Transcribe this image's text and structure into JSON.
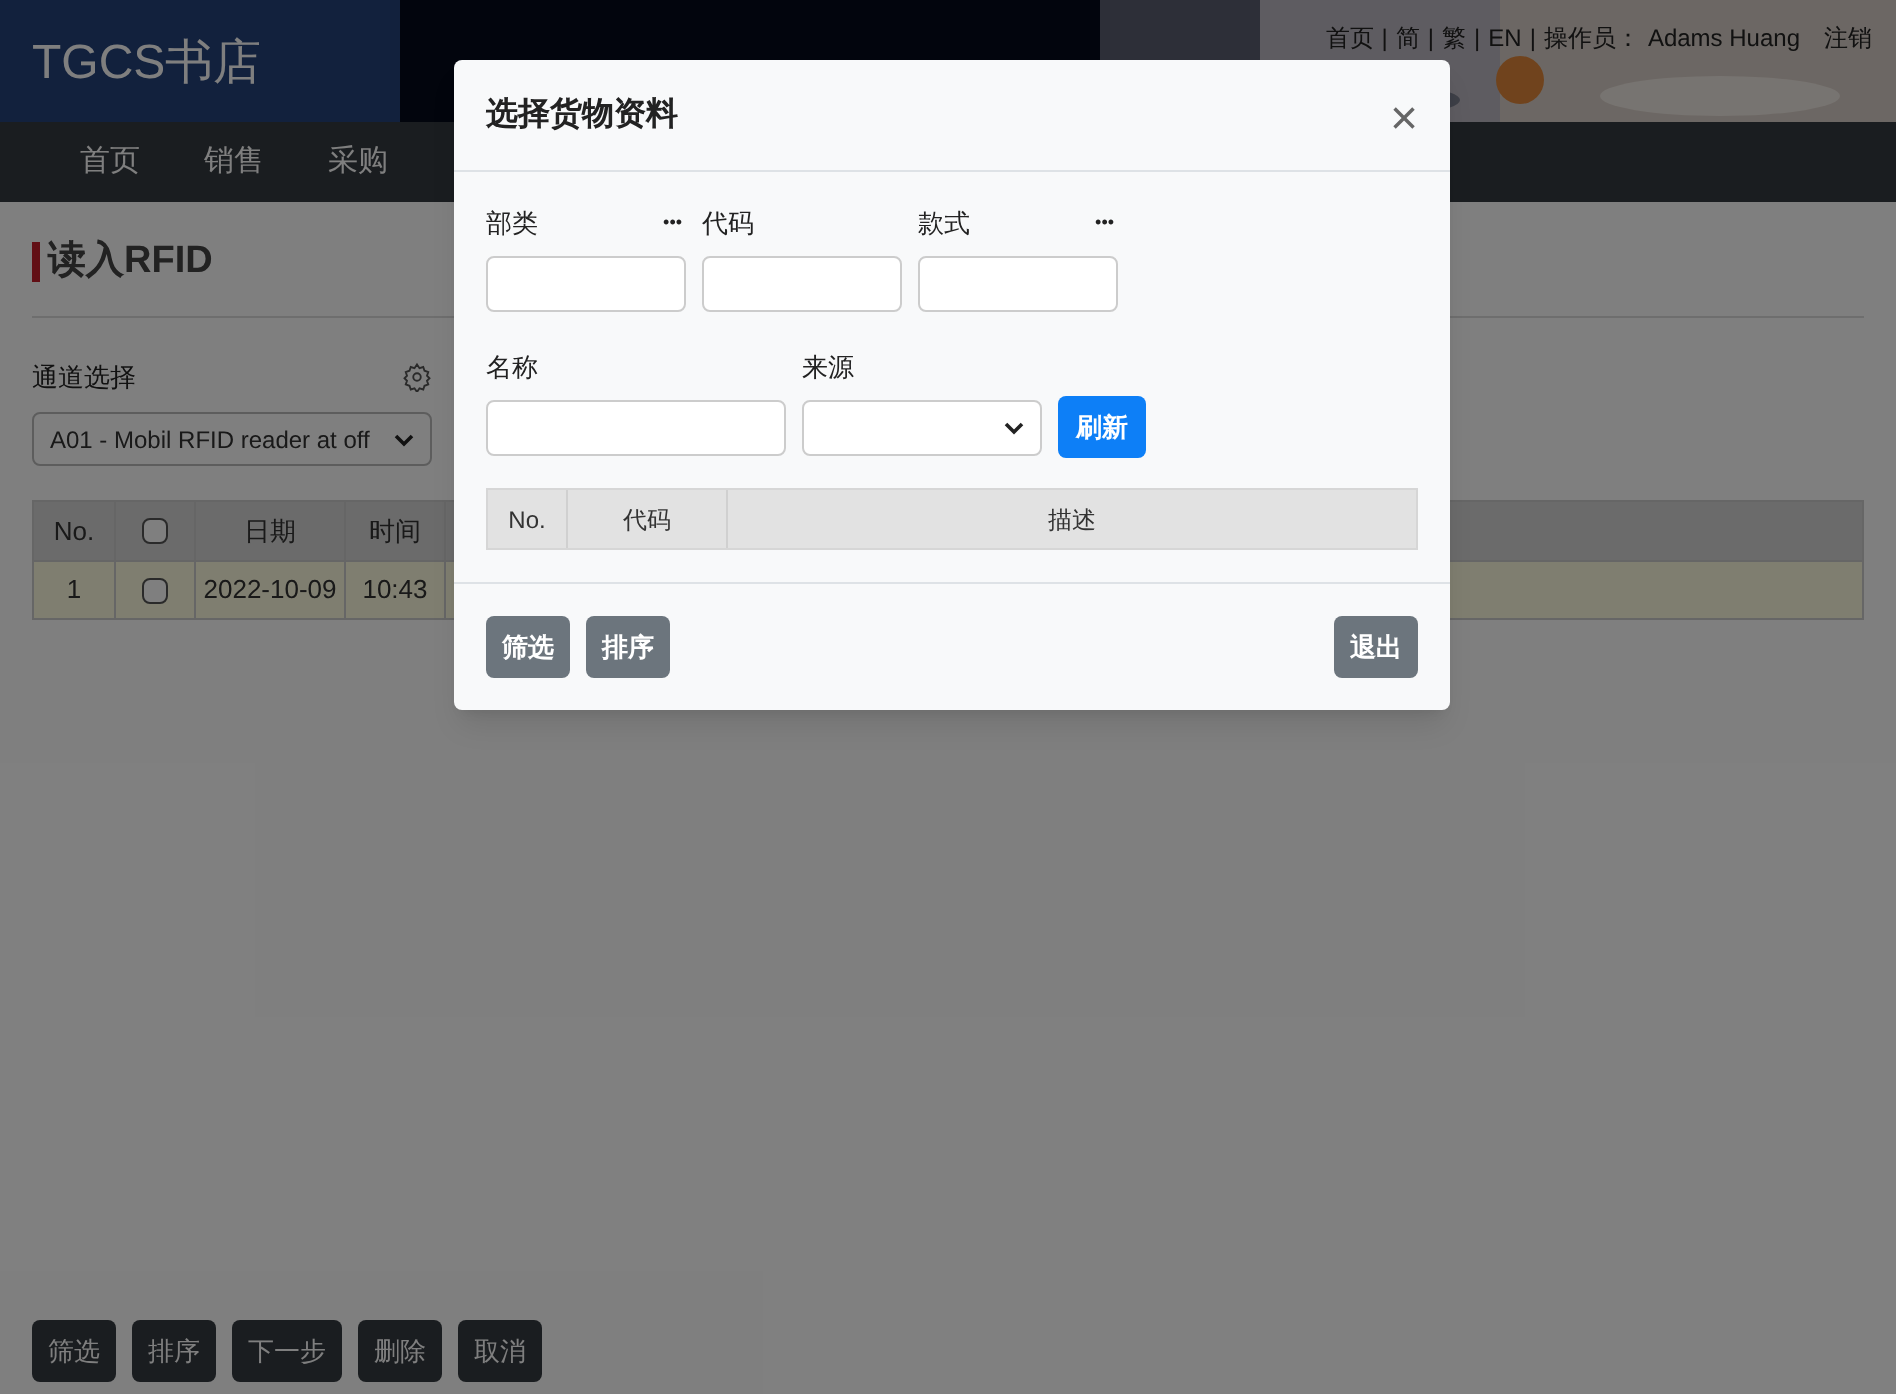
{
  "header": {
    "brand": "TGCS书店",
    "links": [
      "首页",
      "简",
      "繁",
      "EN"
    ],
    "separator": "|",
    "operator_label": "操作员：",
    "operator": "Adams Huang",
    "logout": "注销"
  },
  "nav": [
    {
      "label": "首页"
    },
    {
      "label": "销售"
    },
    {
      "label": "采购"
    }
  ],
  "page": {
    "title": "读入RFID",
    "channel_label": "通道选择",
    "channel_value": "A01 - Mobil RFID reader at off",
    "table": {
      "columns": [
        "No.",
        "",
        "日期",
        "时间"
      ],
      "header_checked": false,
      "rows": [
        {
          "no": "1",
          "checked": false,
          "date": "2022-10-09",
          "time": "10:43"
        }
      ]
    },
    "buttons": [
      "筛选",
      "排序",
      "下一步",
      "删除",
      "取消"
    ]
  },
  "dialog": {
    "title": "选择货物资料",
    "close": "×",
    "fields_row1": [
      {
        "label": "部类",
        "more": "•••"
      },
      {
        "label": "代码"
      },
      {
        "label": "款式",
        "more": "•••"
      }
    ],
    "name_label": "名称",
    "source_label": "来源",
    "refresh": "刷新",
    "columns": [
      "No.",
      "代码",
      "描述"
    ],
    "footer_left": [
      "筛选",
      "排序"
    ],
    "footer_right": "退出"
  }
}
